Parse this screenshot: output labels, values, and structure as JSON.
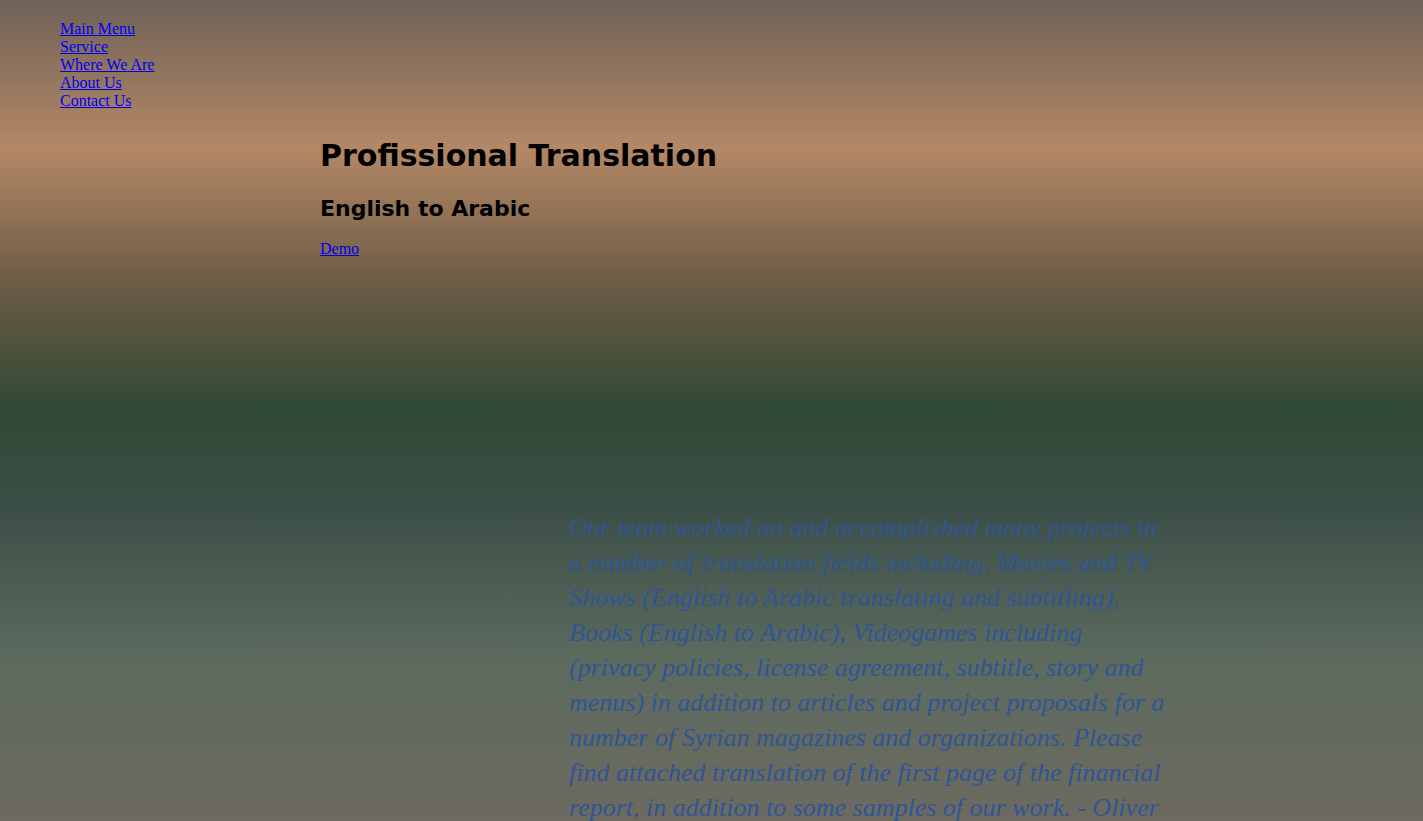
{
  "nav": [
    {
      "label": "Main Menu"
    },
    {
      "label": "Service"
    },
    {
      "label": "Where We Are"
    },
    {
      "label": "About Us"
    },
    {
      "label": "Contact Us"
    }
  ],
  "hero": {
    "title": "Profissional Translation",
    "subtitle": "English to Arabic",
    "link": "Demo"
  },
  "description": "Our team worked on and accomplished many projects in a number of translation fields including, Movies and TV Shows (English to Arabic translating and subtitling), Books (English to Arabic), Videogames including (privacy policies, license agreement, subtitle, story and menus) in addition to articles and project proposals for a number of Syrian magazines and organizations. Please find attached translation of the first page of the financial report, in addition to some samples of our work. - Oliver"
}
